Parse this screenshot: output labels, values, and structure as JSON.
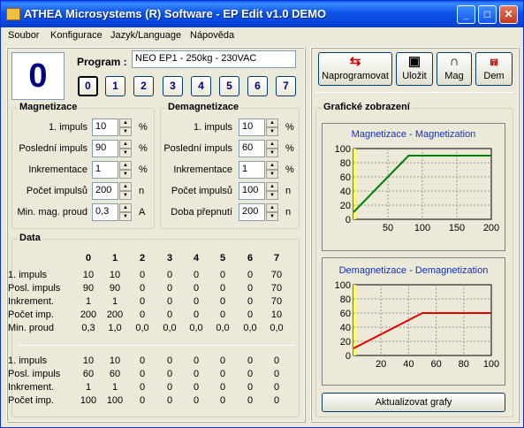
{
  "window": {
    "title": "ATHEA Microsystems (R) Software - EP Edit v1.0 DEMO"
  },
  "menu": [
    "Soubor",
    "Konfigurace",
    "Jazyk/Language",
    "Nápověda"
  ],
  "program": {
    "current": "0",
    "label": "Program :",
    "name": "NEO EP1 - 250kg - 230VAC",
    "buttons": [
      "0",
      "1",
      "2",
      "3",
      "4",
      "5",
      "6",
      "7"
    ]
  },
  "toolbar": {
    "program_label": "Naprogramovat",
    "save_label": "Uložit",
    "mag_label": "Mag",
    "dem_label": "Dem"
  },
  "magnetization": {
    "title": "Magnetizace",
    "fields": [
      {
        "label": "1. impuls",
        "value": "10",
        "unit": "%"
      },
      {
        "label": "Poslední impuls",
        "value": "90",
        "unit": "%"
      },
      {
        "label": "Inkrementace",
        "value": "1",
        "unit": "%"
      },
      {
        "label": "Počet impulsů",
        "value": "200",
        "unit": "n"
      },
      {
        "label": "Min. mag. proud",
        "value": "0,3",
        "unit": "A"
      }
    ]
  },
  "demagnetization": {
    "title": "Demagnetizace",
    "fields": [
      {
        "label": "1. impuls",
        "value": "10",
        "unit": "%"
      },
      {
        "label": "Poslední impuls",
        "value": "60",
        "unit": "%"
      },
      {
        "label": "Inkrementace",
        "value": "1",
        "unit": "%"
      },
      {
        "label": "Počet impulsů",
        "value": "100",
        "unit": "n"
      },
      {
        "label": "Doba přepnutí",
        "value": "200",
        "unit": "n"
      }
    ]
  },
  "data": {
    "title": "Data",
    "columns": [
      "0",
      "1",
      "2",
      "3",
      "4",
      "5",
      "6",
      "7"
    ],
    "mag_rows": [
      {
        "label": "1. impuls",
        "values": [
          "10",
          "10",
          "0",
          "0",
          "0",
          "0",
          "0",
          "70"
        ]
      },
      {
        "label": "Posl. impuls",
        "values": [
          "90",
          "90",
          "0",
          "0",
          "0",
          "0",
          "0",
          "70"
        ]
      },
      {
        "label": "Inkrement.",
        "values": [
          "1",
          "1",
          "0",
          "0",
          "0",
          "0",
          "0",
          "70"
        ]
      },
      {
        "label": "Počet imp.",
        "values": [
          "200",
          "200",
          "0",
          "0",
          "0",
          "0",
          "0",
          "10"
        ]
      },
      {
        "label": "Min. proud",
        "values": [
          "0,3",
          "1,0",
          "0,0",
          "0,0",
          "0,0",
          "0,0",
          "0,0",
          "0,0"
        ]
      }
    ],
    "dem_rows": [
      {
        "label": "1. impuls",
        "values": [
          "10",
          "10",
          "0",
          "0",
          "0",
          "0",
          "0",
          "0"
        ]
      },
      {
        "label": "Posl. impuls",
        "values": [
          "60",
          "60",
          "0",
          "0",
          "0",
          "0",
          "0",
          "0"
        ]
      },
      {
        "label": "Inkrement.",
        "values": [
          "1",
          "1",
          "0",
          "0",
          "0",
          "0",
          "0",
          "0"
        ]
      },
      {
        "label": "Počet imp.",
        "values": [
          "100",
          "100",
          "0",
          "0",
          "0",
          "0",
          "0",
          "0"
        ]
      }
    ]
  },
  "graphs": {
    "title": "Grafické zobrazení",
    "update_label": "Aktualizovat grafy"
  },
  "chart_data": [
    {
      "type": "line",
      "title": "Magnetizace - Magnetization",
      "xlim": [
        0,
        200
      ],
      "ylim": [
        0,
        100
      ],
      "grid": true,
      "color": "#008000",
      "xticks": [
        50,
        100,
        150,
        200
      ],
      "yticks": [
        0,
        20,
        40,
        60,
        80,
        100
      ],
      "series": [
        {
          "x": [
            0,
            80,
            200
          ],
          "y": [
            10,
            90,
            90
          ]
        }
      ]
    },
    {
      "type": "line",
      "title": "Demagnetizace - Demagnetization",
      "xlim": [
        0,
        100
      ],
      "ylim": [
        0,
        100
      ],
      "grid": true,
      "color": "#e00000",
      "xticks": [
        20,
        40,
        60,
        80,
        100
      ],
      "yticks": [
        0,
        20,
        40,
        60,
        80,
        100
      ],
      "series": [
        {
          "x": [
            0,
            50,
            100
          ],
          "y": [
            10,
            60,
            60
          ]
        }
      ]
    }
  ]
}
